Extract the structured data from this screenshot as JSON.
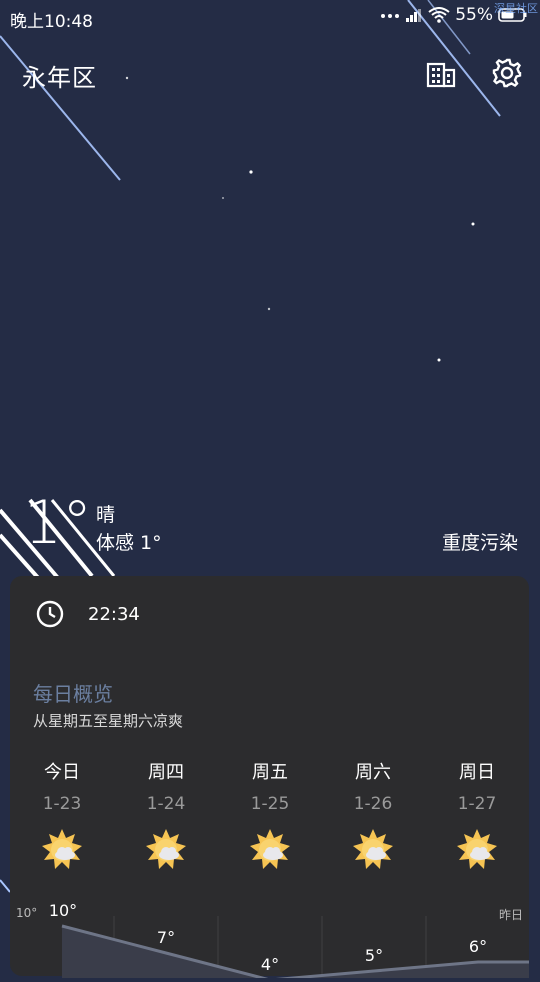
{
  "status_bar": {
    "time": "晚上10:48",
    "battery": "55%",
    "watermark": "深星社区"
  },
  "header": {
    "location": "永年区",
    "icons": [
      "city-icon",
      "settings-icon"
    ]
  },
  "current": {
    "temperature": "1°",
    "condition": "晴",
    "feels_like": "体感 1°",
    "air_quality": "重度污染"
  },
  "card": {
    "update_time": "22:34",
    "overview_title": "每日概览",
    "overview_subtitle": "从星期五至星期六凉爽",
    "days": [
      {
        "name": "今日",
        "date": "1-23",
        "icon": "sun-cloud-icon"
      },
      {
        "name": "周四",
        "date": "1-24",
        "icon": "sun-cloud-icon"
      },
      {
        "name": "周五",
        "date": "1-25",
        "icon": "sun-cloud-icon"
      },
      {
        "name": "周六",
        "date": "1-26",
        "icon": "sun-cloud-icon"
      },
      {
        "name": "周日",
        "date": "1-27",
        "icon": "sun-cloud-icon"
      }
    ],
    "chart": {
      "axis_left_label": "10°",
      "axis_right_label": "昨日",
      "high_temps": [
        10,
        7,
        4,
        5,
        6
      ],
      "high_labels": [
        "10°",
        "7°",
        "4°",
        "5°",
        "6°"
      ]
    }
  },
  "colors": {
    "background": "#242c45",
    "card": "#2c2c2e",
    "sun": "#f6c453",
    "title_accent": "#6b7fa0"
  }
}
